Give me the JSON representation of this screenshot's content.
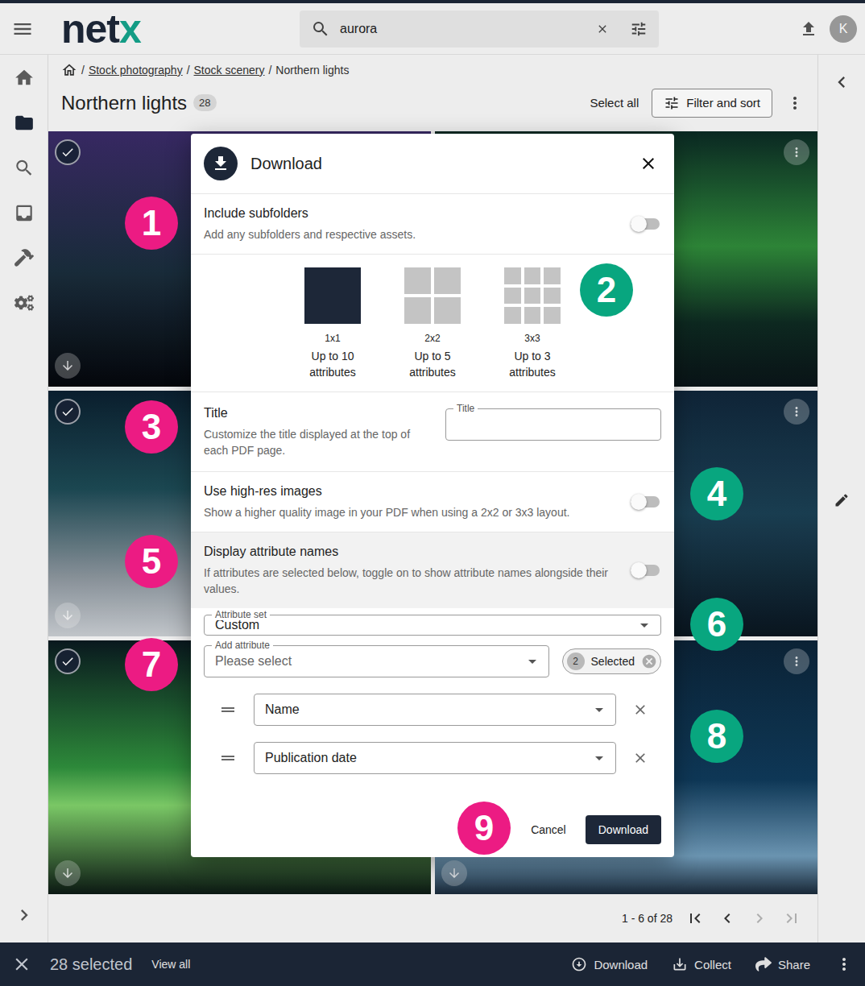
{
  "app": {
    "logo_text": "net",
    "logo_accent": "x",
    "avatar": "K"
  },
  "search": {
    "value": "aurora"
  },
  "sidebar": {
    "items": [
      {
        "selected": false
      },
      {
        "selected": true
      },
      {
        "selected": false
      },
      {
        "selected": false
      },
      {
        "selected": false
      },
      {
        "selected": false
      }
    ]
  },
  "breadcrumb": {
    "separator": "/",
    "items": [
      {
        "label": "Stock photography",
        "link": true
      },
      {
        "label": "Stock scenery",
        "link": true
      },
      {
        "label": "Northern lights",
        "link": false
      }
    ]
  },
  "folder": {
    "title": "Northern lights",
    "count": "28"
  },
  "toolbar": {
    "select_all": "Select all",
    "filter": "Filter and sort"
  },
  "tiles": [
    {
      "selected": true
    },
    {
      "selected": true
    },
    {
      "selected": true
    },
    {
      "selected": true
    },
    {
      "selected": true
    },
    {
      "selected": true
    }
  ],
  "pagination": {
    "range": "1 - 6 of 28",
    "buttons": [
      {
        "disabled": false
      },
      {
        "disabled": false
      },
      {
        "disabled": true
      },
      {
        "disabled": true
      }
    ]
  },
  "selection_bar": {
    "count": "28 selected",
    "view_all": "View all",
    "actions": [
      {
        "label": "Download"
      },
      {
        "label": "Collect"
      },
      {
        "label": "Share"
      }
    ]
  },
  "dialog": {
    "title": "Download",
    "include_subfolders": {
      "label": "Include subfolders",
      "description": "Add any subfolders and respective assets.",
      "on": false,
      "hovered": false
    },
    "layouts": [
      {
        "label": "1x1",
        "caption": "Up to 10 attributes",
        "cells": 1,
        "selected": true
      },
      {
        "label": "2x2",
        "caption": "Up to 5 attributes",
        "cells": 2,
        "selected": false
      },
      {
        "label": "3x3",
        "caption": "Up to 3 attributes",
        "cells": 3,
        "selected": false
      }
    ],
    "title_field": {
      "label": "Title",
      "description": "Customize the title displayed at the top of each PDF page.",
      "field_label": "Title",
      "value": ""
    },
    "high_res": {
      "label": "Use high-res images",
      "description": "Show a higher quality image in your PDF when using a 2x2 or 3x3 layout.",
      "on": false,
      "hovered": false
    },
    "attribute_names": {
      "label": "Display attribute names",
      "description": "If attributes are selected below, toggle on to show attribute names alongside their values.",
      "on": false,
      "hovered": true
    },
    "attribute_set": {
      "label": "Attribute set",
      "value": "Custom"
    },
    "add_attribute": {
      "label": "Add attribute",
      "placeholder": "Please select",
      "chip_count": "2",
      "chip_label": "Selected"
    },
    "attributes": [
      {
        "value": "Name"
      },
      {
        "value": "Publication date"
      }
    ],
    "buttons": {
      "cancel": "Cancel",
      "confirm": "Download"
    }
  },
  "annotations": [
    {
      "label": "1",
      "color": "#ec1b83"
    },
    {
      "label": "2",
      "color": "#08a67f"
    },
    {
      "label": "3",
      "color": "#ec1b83"
    },
    {
      "label": "4",
      "color": "#08a67f"
    },
    {
      "label": "5",
      "color": "#ec1b83"
    },
    {
      "label": "6",
      "color": "#08a67f"
    },
    {
      "label": "7",
      "color": "#ec1b83"
    },
    {
      "label": "8",
      "color": "#08a67f"
    },
    {
      "label": "9",
      "color": "#ec1b83"
    }
  ]
}
